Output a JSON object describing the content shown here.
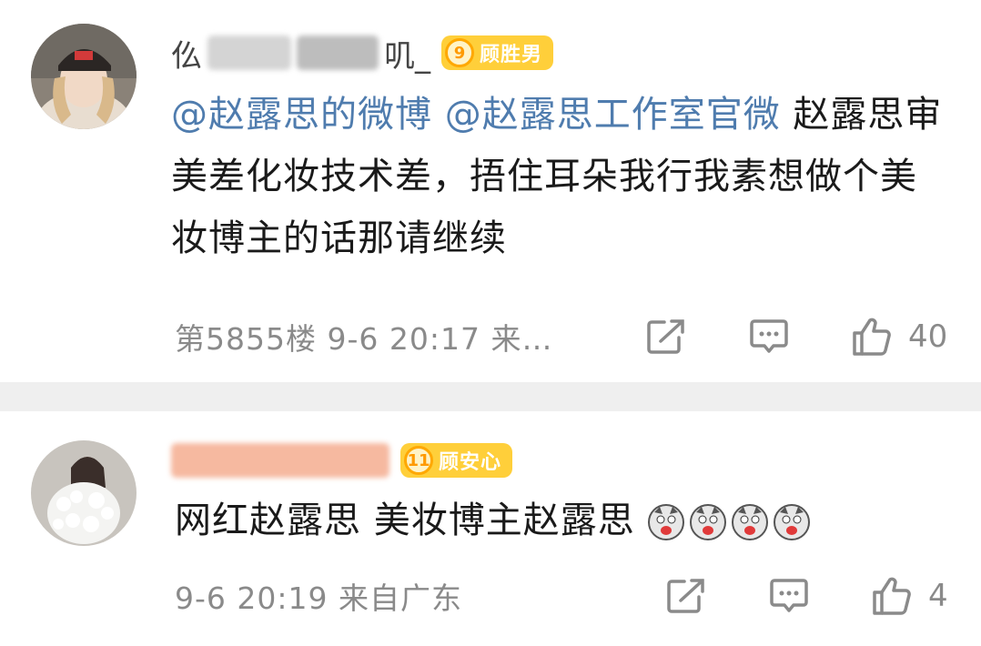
{
  "comments": [
    {
      "username_visible_start": "仫",
      "username_visible_end": "叽_",
      "badge_level": "9",
      "badge_label": "顾胜男",
      "mention1": "@赵露思的微博",
      "mention2": "@赵露思工作室官微",
      "text": " 赵露思审美差化妆技术差，捂住耳朵我行我素想做个美妆博主的话那请继续",
      "meta": "第5855楼  9-6 20:17  来…",
      "likes": "40"
    },
    {
      "badge_level": "11",
      "badge_label": "顾安心",
      "text": "网红赵露思 美妆博主赵露思",
      "emoji": [
        "dog-emoji",
        "dog-emoji",
        "dog-emoji",
        "dog-emoji"
      ],
      "meta": "9-6 20:19  来自广东",
      "likes": "4"
    }
  ],
  "colors": {
    "mention": "#4f7cae",
    "badge": "#ffcf3a",
    "meta": "#8a8a8a",
    "divider": "#efefef"
  }
}
